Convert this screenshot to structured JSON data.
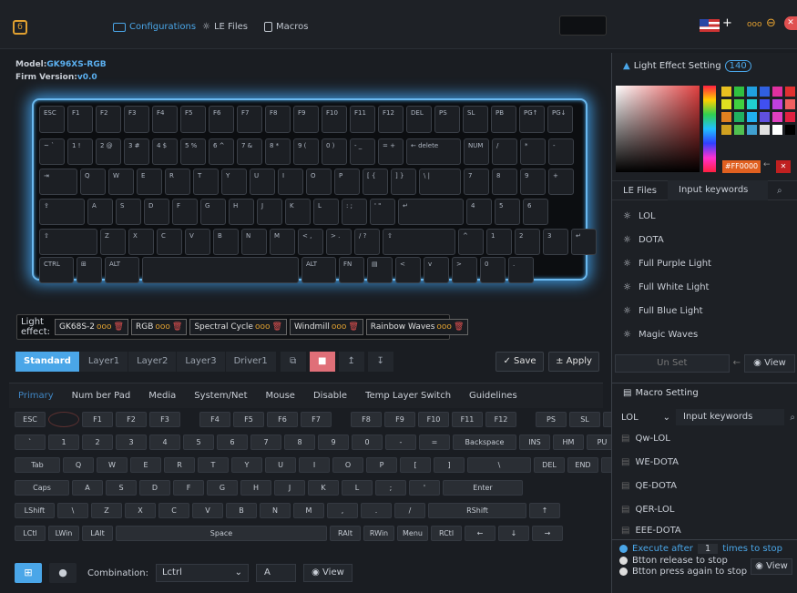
{
  "nav": {
    "tabs": [
      {
        "label": "Configurations",
        "active": true
      },
      {
        "label": "LE Files",
        "active": false
      },
      {
        "label": "Macros",
        "active": false
      }
    ],
    "window": {
      "menu": "ooo",
      "minimize": "⊖",
      "close": "✕"
    }
  },
  "device": {
    "model_label": "Model:",
    "model": "GK96XS-RGB",
    "firm_label": "Firm Version:",
    "firm": "v0.0"
  },
  "keyboard": {
    "rows": [
      [
        "ESC",
        "F1",
        "F2",
        "F3",
        "F4",
        "F5",
        "F6",
        "F7",
        "F8",
        "F9",
        "F10",
        "F11",
        "F12",
        "DEL",
        "PS",
        "SL",
        "PB",
        "PG↑",
        "PG↓"
      ],
      [
        "~ `",
        "1 !",
        "2 @",
        "3 #",
        "4 $",
        "5 %",
        "6 ^",
        "7 &",
        "8 *",
        "9 (",
        "0 )",
        "- _",
        "= +",
        "←\ndelete",
        "NUM",
        "/",
        "*",
        "-"
      ],
      [
        "⇥",
        "Q",
        "W",
        "E",
        "R",
        "T",
        "Y",
        "U",
        "I",
        "O",
        "P",
        "[ {",
        "] }",
        "\\ |",
        "7",
        "8",
        "9",
        "+"
      ],
      [
        "⇪",
        "A",
        "S",
        "D",
        "F",
        "G",
        "H",
        "J",
        "K",
        "L",
        ": ;",
        "' \"",
        "↵",
        "4",
        "5",
        "6"
      ],
      [
        "⇧",
        "Z",
        "X",
        "C",
        "V",
        "B",
        "N",
        "M",
        "< ,",
        "> .",
        "/ ?",
        "⇧",
        "^",
        "1",
        "2",
        "3",
        "↵"
      ],
      [
        "CTRL",
        "⊞",
        "ALT",
        "",
        "ALT",
        "FN",
        "▤",
        "<",
        "v",
        ">",
        "0",
        "."
      ]
    ]
  },
  "light_effect": {
    "label": "Light effect:",
    "items": [
      "GK68S-2",
      "RGB",
      "Spectral Cycle",
      "Windmill",
      "Rainbow Waves"
    ],
    "dots": "ooo",
    "delete_icon": "🗑"
  },
  "layers": {
    "tabs": [
      "Standard",
      "Layer1",
      "Layer2",
      "Layer3",
      "Driver1"
    ],
    "tools": [
      "⧉",
      "■",
      "↥",
      "↧"
    ],
    "save": "✓ Save",
    "apply": "± Apply"
  },
  "categories": [
    "Primary",
    "Num ber Pad",
    "Media",
    "System/Net",
    "Mouse",
    "Disable",
    "Temp Layer Switch",
    "Guidelines"
  ],
  "vkeys": {
    "row1": [
      "ESC",
      "",
      "F1",
      "F2",
      "F3",
      "F4",
      "F5",
      "F6",
      "F7",
      "F8",
      "F9",
      "F10",
      "F11",
      "F12",
      "PS",
      "SL",
      "PB"
    ],
    "row2": [
      "`",
      "1",
      "2",
      "3",
      "4",
      "5",
      "6",
      "7",
      "8",
      "9",
      "0",
      "-",
      "=",
      "Backspace",
      "INS",
      "HM",
      "PU"
    ],
    "row3": [
      "Tab",
      "Q",
      "W",
      "E",
      "R",
      "T",
      "Y",
      "U",
      "I",
      "O",
      "P",
      "[",
      "]",
      "\\",
      "DEL",
      "END",
      "PD"
    ],
    "row4": [
      "Caps",
      "A",
      "S",
      "D",
      "F",
      "G",
      "H",
      "J",
      "K",
      "L",
      ";",
      "'",
      "Enter"
    ],
    "row5": [
      "LShift",
      "\\",
      "Z",
      "X",
      "C",
      "V",
      "B",
      "N",
      "M",
      ",",
      ".",
      "/",
      "RShift",
      "↑"
    ],
    "row6": [
      "LCtl",
      "LWin",
      "LAlt",
      "Space",
      "RAlt",
      "RWin",
      "Menu",
      "RCtl",
      "←",
      "↓",
      "→"
    ]
  },
  "bottom": {
    "combination_label": "Combination:",
    "combination_value": "Lctrl",
    "key": "A",
    "view": "View"
  },
  "light_setting": {
    "title": "Light Effect Setting",
    "count": "140",
    "hex": "#FF0000",
    "swatches": [
      "#e8c020",
      "#30c040",
      "#20a0e0",
      "#3060e0",
      "#e030a0",
      "#e03030",
      "#e0e020",
      "#40d040",
      "#20d0d0",
      "#4050f0",
      "#c040e0",
      "#f06060",
      "#e08020",
      "#20b060",
      "#20b0f0",
      "#6050e0",
      "#e040c0",
      "#e02040",
      "#d0a020",
      "#50c050",
      "#40a0d0",
      "#e0e0e0",
      "#ffffff",
      "#000000"
    ],
    "tabs": [
      "LE Files",
      "Input keywords"
    ],
    "items": [
      "LOL",
      "DOTA",
      "Full Purple Light",
      "Full White Light",
      "Full Blue Light",
      "Magic Waves"
    ],
    "unset": "Un Set",
    "view": "View"
  },
  "macro": {
    "title": "Macro Setting",
    "filter": "LOL",
    "placeholder": "Input keywords",
    "items": [
      "Qw-LOL",
      "WE-DOTA",
      "QE-DOTA",
      "QER-LOL",
      "EEE-DOTA"
    ],
    "opt1_a": "Execute after",
    "opt1_n": "1",
    "opt1_b": "times to stop",
    "opt2": "Btton release to stop",
    "opt3": "Btton press again to stop",
    "view": "View"
  },
  "colors": {
    "accent": "#4aa6e8",
    "orange": "#e0a030",
    "danger": "#e05050"
  }
}
